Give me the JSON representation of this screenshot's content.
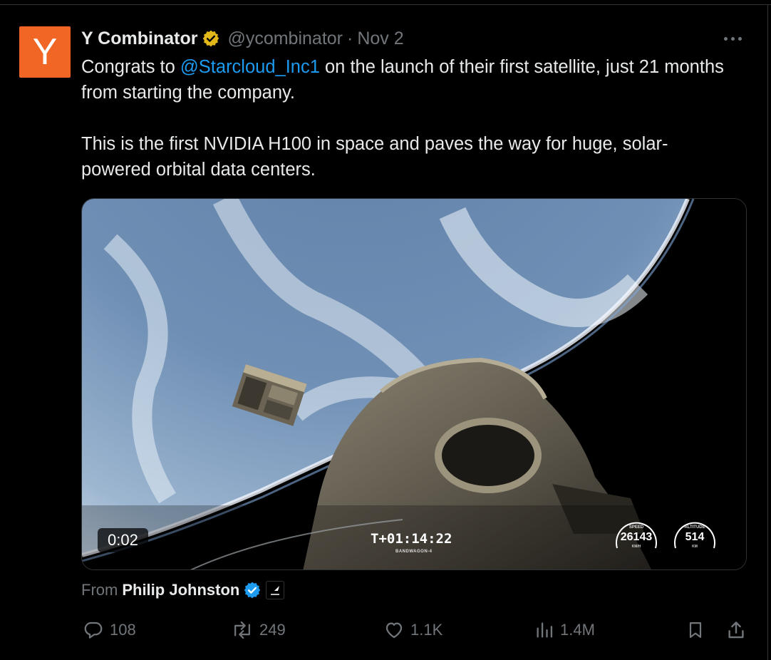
{
  "tweet": {
    "author": {
      "avatar_letter": "Y",
      "display_name": "Y Combinator",
      "handle": "@ycombinator",
      "separator": "·",
      "date": "Nov 2",
      "badge_color": "#e2b719",
      "avatar_color": "#f26625"
    },
    "text": {
      "line1_prefix": "Congrats to ",
      "mention": "@Starcloud_Inc1",
      "line1_suffix": " on the launch of their first satellite, just 21 months from starting the company.",
      "paragraph2": "This is the first NVIDIA H100 in space and paves the way for huge, solar-powered orbital data centers."
    },
    "media": {
      "timestamp": "0:02",
      "t_clock": "T+01:14:22",
      "mission": "BANDWAGON-4",
      "speed": {
        "label": "SPEED",
        "value": "26143",
        "unit": "KM/H"
      },
      "altitude": {
        "label": "ALTITUDE",
        "value": "514",
        "unit": "KM"
      }
    },
    "from": {
      "label": "From",
      "name": "Philip Johnston"
    },
    "actions": {
      "replies": "108",
      "reposts": "249",
      "likes": "1.1K",
      "views": "1.4M"
    },
    "icons": [
      "more-icon",
      "verified-gold-icon",
      "verified-blue-icon",
      "reply-icon",
      "repost-icon",
      "like-icon",
      "views-icon",
      "bookmark-icon",
      "share-icon"
    ],
    "colors": {
      "link": "#1d9bf0",
      "muted": "#71767b",
      "text": "#e7e9ea"
    }
  }
}
